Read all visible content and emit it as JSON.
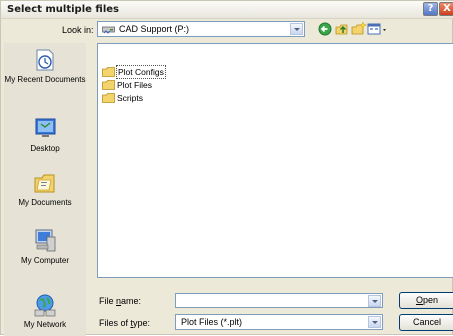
{
  "window": {
    "title": "Select multiple files",
    "help_symbol": "?",
    "close_symbol": "X"
  },
  "look_in": {
    "label": "Look in:",
    "value": "CAD Support (P:)"
  },
  "toolbar": {
    "icons": [
      "back-icon",
      "up-folder-icon",
      "new-folder-icon",
      "views-menu-icon"
    ]
  },
  "places": [
    {
      "label": "My Recent Documents",
      "icon": "recent-documents-icon"
    },
    {
      "label": "Desktop",
      "icon": "desktop-icon"
    },
    {
      "label": "My Documents",
      "icon": "my-documents-icon"
    },
    {
      "label": "My Computer",
      "icon": "my-computer-icon"
    },
    {
      "label": "My Network",
      "icon": "my-network-icon"
    }
  ],
  "files": [
    {
      "name": "Plot Configs",
      "type": "folder",
      "selected": true
    },
    {
      "name": "Plot Files",
      "type": "folder",
      "selected": false
    },
    {
      "name": "Scripts",
      "type": "folder",
      "selected": false
    }
  ],
  "file_name": {
    "label_pre": "File ",
    "label_u": "n",
    "label_post": "ame:",
    "value": ""
  },
  "file_type": {
    "label_pre": "Files of ",
    "label_u": "t",
    "label_post": "ype:",
    "value": "Plot Files (*.plt)"
  },
  "buttons": {
    "open_u": "O",
    "open_rest": "pen",
    "cancel": "Cancel"
  },
  "colors": {
    "dialog_bg": "#ece9d8",
    "folder_yellow": "#f3d36b",
    "border_blue": "#7f9db9"
  }
}
